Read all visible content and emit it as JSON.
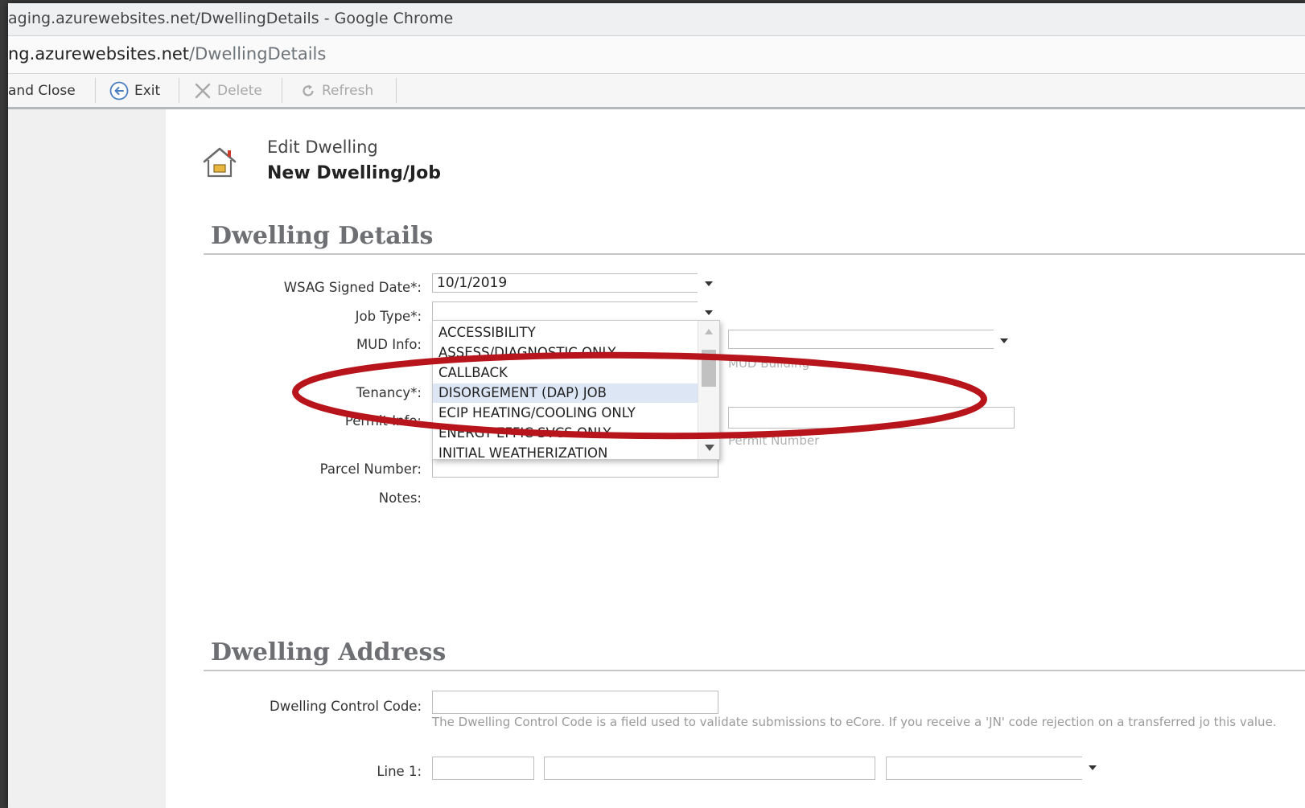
{
  "window": {
    "title": "aging.azurewebsites.net/DwellingDetails - Google Chrome"
  },
  "url": {
    "host": "ng.azurewebsites.net",
    "path": "/DwellingDetails"
  },
  "toolbar": {
    "save_close": "and Close",
    "exit": "Exit",
    "delete": "Delete",
    "refresh": "Refresh"
  },
  "header": {
    "subtitle": "Edit Dwelling",
    "title": "New Dwelling/Job"
  },
  "details": {
    "section_title": "Dwelling Details",
    "wsag_label": "WSAG Signed Date*:",
    "wsag_value": "10/1/2019",
    "jobtype_label": "Job Type*:",
    "jobtype_value": "",
    "mud_label": "MUD Info:",
    "mud_hint": "MUD Building",
    "tenancy_label": "Tenancy*:",
    "permit_label": "Permit Info:",
    "permit_hint": "Permit Number",
    "parcel_label": "Parcel Number:",
    "notes_label": "Notes:"
  },
  "jobtype_options": [
    "ACCESSIBILITY",
    "ASSESS/DIAGNOSTIC ONLY",
    "CALLBACK",
    "DISORGEMENT (DAP) JOB",
    "ECIP HEATING/COOLING ONLY",
    "ENERGY EFFIC SVCS ONLY",
    "INITIAL WEATHERIZATION"
  ],
  "address": {
    "section_title": "Dwelling Address",
    "control_code_label": "Dwelling Control Code:",
    "control_code_help": "The Dwelling Control Code is a field used to validate submissions to eCore. If you receive a 'JN' code rejection on a transferred jo this value.",
    "line1_label": "Line 1:"
  },
  "colors": {
    "annotation": "#b8141b",
    "selected_row": "#dde6f5",
    "section_title": "#6d6f72"
  },
  "icons": [
    "back-arrow-icon",
    "close-x-icon",
    "refresh-icon",
    "house-icon",
    "chevron-down-icon"
  ]
}
